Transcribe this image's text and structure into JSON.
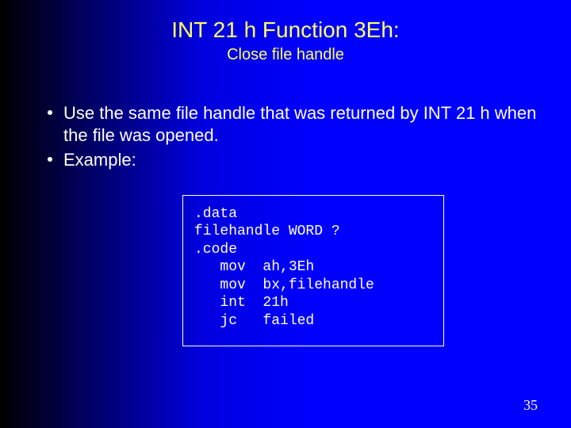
{
  "title": "INT 21 h Function 3Eh:",
  "subtitle": "Close file handle",
  "bullets": [
    "Use the same file handle that was returned by INT 21 h when the file was opened.",
    "Example:"
  ],
  "code": ".data\nfilehandle WORD ?\n.code\n   mov  ah,3Eh\n   mov  bx,filehandle\n   int  21h\n   jc   failed",
  "page_number": "35"
}
